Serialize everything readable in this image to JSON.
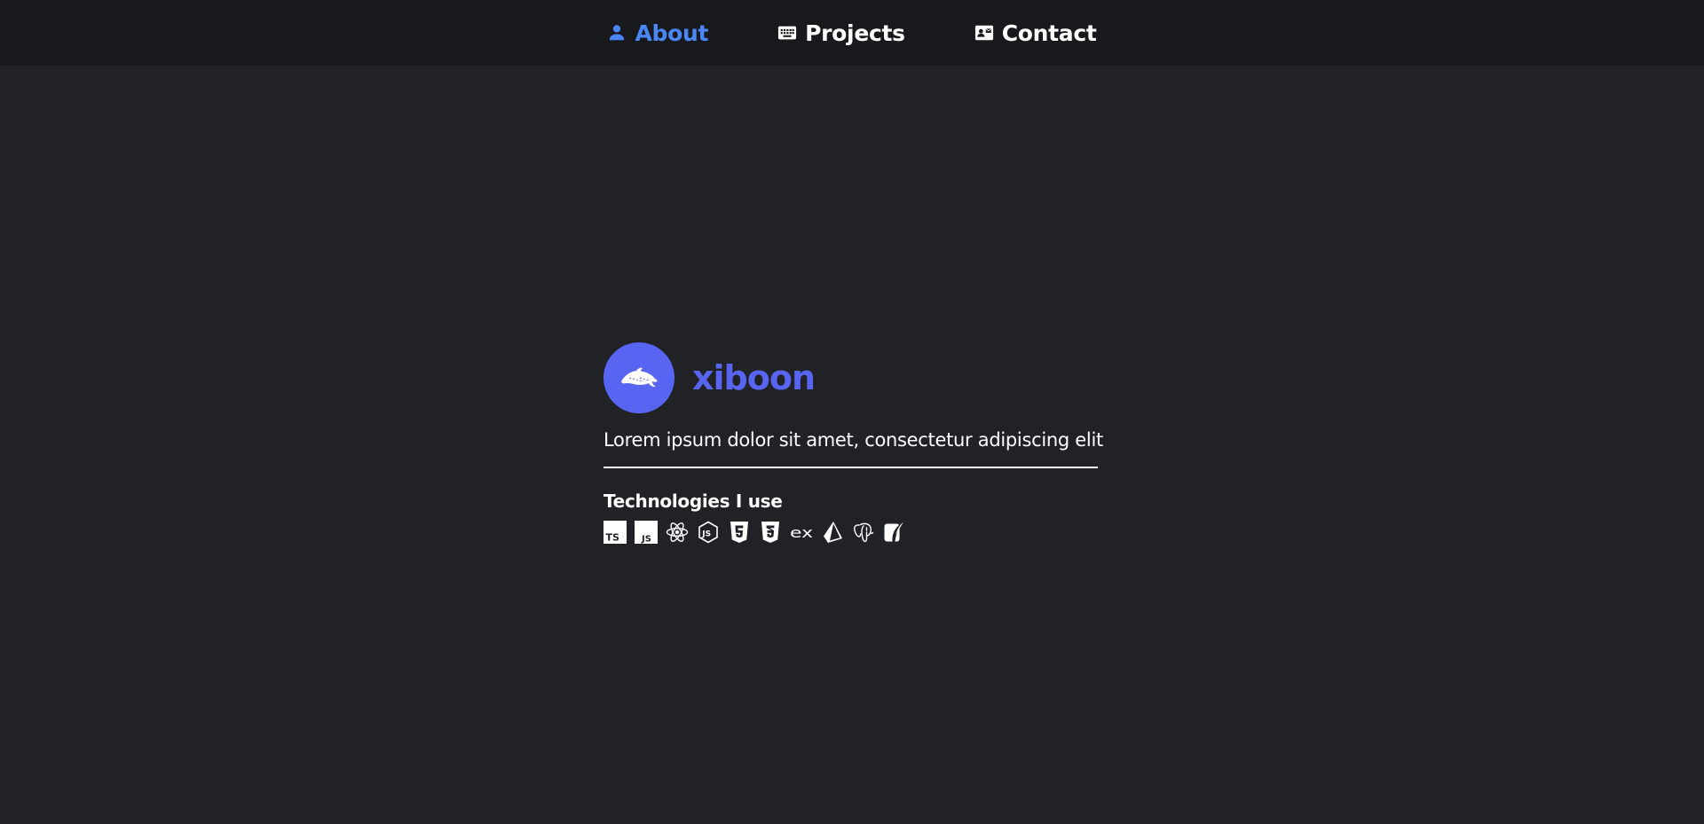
{
  "nav": {
    "items": [
      {
        "label": "About",
        "icon": "person-icon",
        "active": true
      },
      {
        "label": "Projects",
        "icon": "keyboard-icon",
        "active": false
      },
      {
        "label": "Contact",
        "icon": "contact-card-icon",
        "active": false
      }
    ]
  },
  "profile": {
    "avatar_icon": "dolphin-icon",
    "username": "xiboon",
    "bio": "Lorem ipsum dolor sit amet, consectetur adipiscing elit"
  },
  "technologies": {
    "heading": "Technologies I use",
    "icons": [
      "typescript-icon",
      "javascript-icon",
      "react-icon",
      "nodejs-icon",
      "html5-icon",
      "css3-icon",
      "express-icon",
      "prisma-icon",
      "postgresql-icon",
      "sqlite-icon"
    ]
  },
  "colors": {
    "background": "#212226",
    "navbar": "#18191d",
    "nav_active": "#4a86f5",
    "accent": "#5865f2",
    "text": "#ffffff"
  }
}
